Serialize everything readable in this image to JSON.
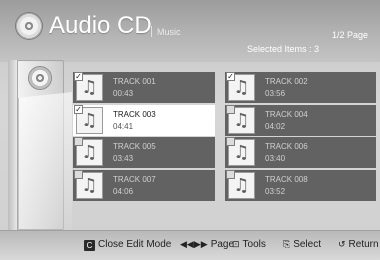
{
  "header": {
    "title": "Audio CD",
    "subtitle": "Music",
    "page_indicator": "1/2 Page",
    "selected_items": "Selected Items : 3"
  },
  "tracks": [
    {
      "name": "TRACK 001",
      "time": "00:43",
      "checked": true,
      "focused": false
    },
    {
      "name": "TRACK 002",
      "time": "03:56",
      "checked": true,
      "focused": false
    },
    {
      "name": "TRACK 003",
      "time": "04:41",
      "checked": true,
      "focused": true
    },
    {
      "name": "TRACK 004",
      "time": "04:02",
      "checked": false,
      "focused": false
    },
    {
      "name": "TRACK 005",
      "time": "03:43",
      "checked": false,
      "focused": false
    },
    {
      "name": "TRACK 006",
      "time": "03:40",
      "checked": false,
      "focused": false
    },
    {
      "name": "TRACK 007",
      "time": "04:06",
      "checked": false,
      "focused": false
    },
    {
      "name": "TRACK 008",
      "time": "03:52",
      "checked": false,
      "focused": false
    }
  ],
  "footer": {
    "close_key": "C",
    "close_label": "Close Edit Mode",
    "page_glyph": "◀◀▶▶",
    "page_label": "Page",
    "tools_glyph": "⊡",
    "tools_label": "Tools",
    "select_glyph": "⎘",
    "select_label": "Select",
    "return_glyph": "↺",
    "return_label": "Return"
  },
  "icons": {
    "cd": "cd-icon",
    "note": "music-note-icon"
  },
  "colors": {
    "track_bg": "#626262",
    "focused_bg": "#ffffff",
    "text_light": "#ffffff"
  }
}
